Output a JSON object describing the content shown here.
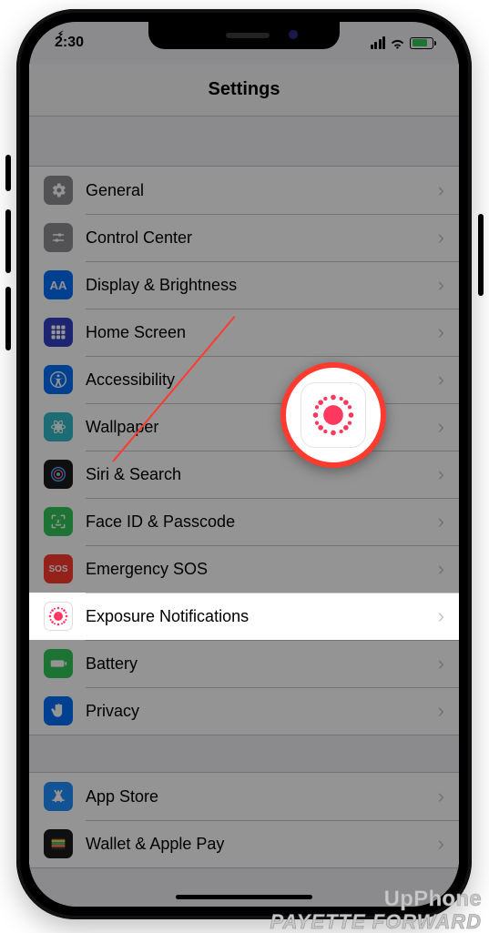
{
  "status": {
    "time": "2:30"
  },
  "header": {
    "title": "Settings"
  },
  "groups": [
    {
      "rows": [
        {
          "id": "general",
          "label": "General",
          "icon": "gear-icon"
        },
        {
          "id": "control-center",
          "label": "Control Center",
          "icon": "sliders-icon"
        },
        {
          "id": "display-brightness",
          "label": "Display & Brightness",
          "icon": "aa-icon"
        },
        {
          "id": "home-screen",
          "label": "Home Screen",
          "icon": "grid-icon"
        },
        {
          "id": "accessibility",
          "label": "Accessibility",
          "icon": "accessibility-icon"
        },
        {
          "id": "wallpaper",
          "label": "Wallpaper",
          "icon": "flower-icon"
        },
        {
          "id": "siri-search",
          "label": "Siri & Search",
          "icon": "siri-icon"
        },
        {
          "id": "face-id-passcode",
          "label": "Face ID & Passcode",
          "icon": "face-icon"
        },
        {
          "id": "emergency-sos",
          "label": "Emergency SOS",
          "icon": "sos-icon"
        },
        {
          "id": "exposure-notifications",
          "label": "Exposure Notifications",
          "icon": "exposure-icon",
          "highlight": true
        },
        {
          "id": "battery",
          "label": "Battery",
          "icon": "battery-icon"
        },
        {
          "id": "privacy",
          "label": "Privacy",
          "icon": "hand-icon"
        }
      ]
    },
    {
      "rows": [
        {
          "id": "app-store",
          "label": "App Store",
          "icon": "appstore-icon"
        },
        {
          "id": "wallet-apple-pay",
          "label": "Wallet & Apple Pay",
          "icon": "wallet-icon"
        }
      ]
    }
  ],
  "callout": {
    "target_row": "exposure-notifications",
    "icon": "exposure-icon"
  },
  "watermark": {
    "line1": "UpPhone",
    "line2": "PAYETTE FORWARD"
  },
  "colors": {
    "accent_red": "#ff3b30",
    "ios_bg": "#efeff4"
  }
}
